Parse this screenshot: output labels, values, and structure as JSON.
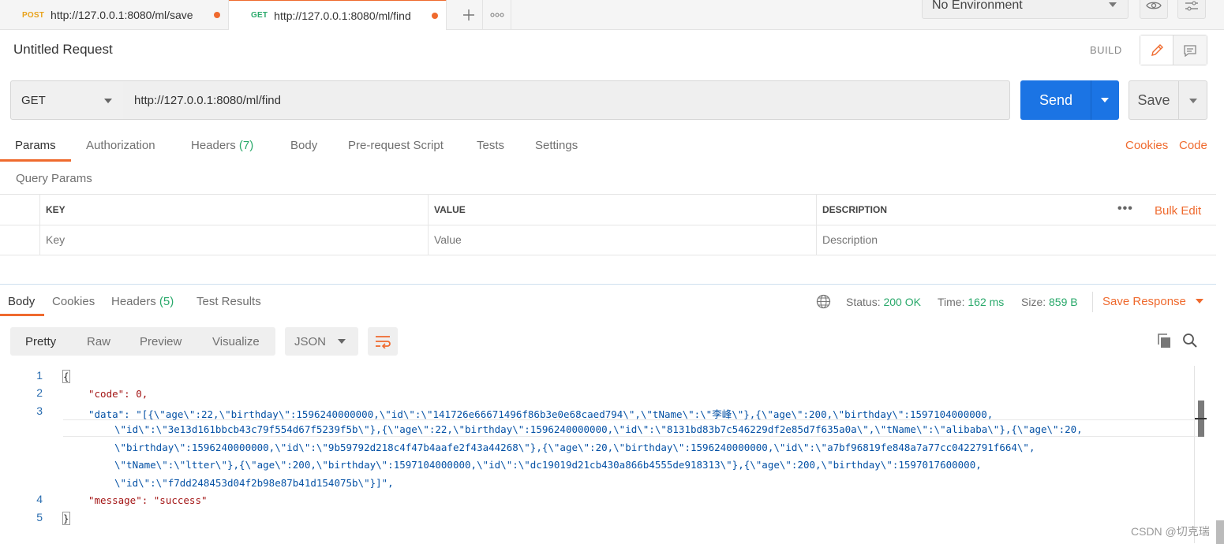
{
  "tabs": [
    {
      "method": "POST",
      "url": "http://127.0.0.1:8080/ml/save"
    },
    {
      "method": "GET",
      "url": "http://127.0.0.1:8080/ml/find"
    }
  ],
  "environment": "No Environment",
  "request": {
    "title": "Untitled Request",
    "mode_label": "BUILD",
    "method": "GET",
    "url": "http://127.0.0.1:8080/ml/find",
    "send_label": "Send",
    "save_label": "Save"
  },
  "request_tabs": {
    "params": "Params",
    "authorization": "Authorization",
    "headers": "Headers",
    "headers_count": "(7)",
    "body": "Body",
    "prerequest": "Pre-request Script",
    "tests": "Tests",
    "settings": "Settings",
    "cookies": "Cookies",
    "code": "Code"
  },
  "query_params": {
    "title": "Query Params",
    "columns": {
      "key": "KEY",
      "value": "VALUE",
      "description": "DESCRIPTION"
    },
    "placeholders": {
      "key": "Key",
      "value": "Value",
      "description": "Description"
    },
    "bulk_edit": "Bulk Edit"
  },
  "response": {
    "tabs": {
      "body": "Body",
      "cookies": "Cookies",
      "headers": "Headers",
      "headers_count": "(5)",
      "tests": "Test Results"
    },
    "status_label": "Status:",
    "status": "200 OK",
    "time_label": "Time:",
    "time": "162 ms",
    "size_label": "Size:",
    "size": "859 B",
    "save_response": "Save Response",
    "views": {
      "pretty": "Pretty",
      "raw": "Raw",
      "preview": "Preview",
      "visualize": "Visualize"
    },
    "format": "JSON",
    "line_numbers": [
      "1",
      "2",
      "3",
      "4",
      "5"
    ],
    "body_lines": [
      "{",
      "\"code\": 0,",
      "\"data\": \"[{\\\"age\\\":22,\\\"birthday\\\":1596240000000,\\\"id\\\":\\\"141726e66671496f86b3e0e68caed794\\\",\\\"tName\\\":\\\"李峰\\\"},{\\\"age\\\":200,\\\"birthday\\\":1597104000000,",
      "\\\"id\\\":\\\"3e13d161bbcb43c79f554d67f5239f5b\\\"},{\\\"age\\\":22,\\\"birthday\\\":1596240000000,\\\"id\\\":\\\"8131bd83b7c546229df2e85d7f635a0a\\\",\\\"tName\\\":\\\"alibaba\\\"},{\\\"age\\\":20,",
      "\\\"birthday\\\":1596240000000,\\\"id\\\":\\\"9b59792d218c4f47b4aafe2f43a44268\\\"},{\\\"age\\\":20,\\\"birthday\\\":1596240000000,\\\"id\\\":\\\"a7bf96819fe848a7a77cc0422791f664\\\",",
      "\\\"tName\\\":\\\"ltter\\\"},{\\\"age\\\":200,\\\"birthday\\\":1597104000000,\\\"id\\\":\\\"dc19019d21cb430a866b4555de918313\\\"},{\\\"age\\\":200,\\\"birthday\\\":1597017600000,",
      "\\\"id\\\":\\\"f7dd248453d04f2b98e87b41d154075b\\\"}]\",",
      "\"message\": \"success\"",
      "}"
    ]
  },
  "watermark": "CSDN @切克瑞",
  "colors": {
    "accent": "#ef6a2e",
    "send": "#1b74e4",
    "success": "#2aa96b"
  }
}
